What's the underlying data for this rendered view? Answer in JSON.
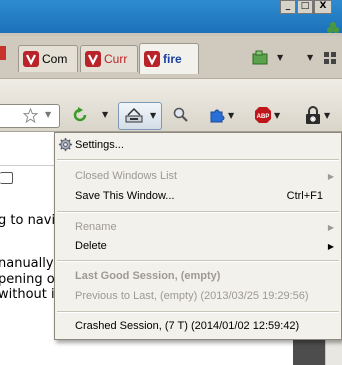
{
  "window": {
    "controls": [
      "_",
      "□",
      "X"
    ]
  },
  "tabs": [
    {
      "label": "Com",
      "selected": false
    },
    {
      "label": "Curr",
      "selected": false
    },
    {
      "label": "fire",
      "selected": true
    }
  ],
  "page": {
    "lines": [
      "g to navi",
      "nanually c",
      "pening of",
      "without i"
    ]
  },
  "menu": {
    "settings": "Settings...",
    "closed_windows": "Closed Windows List",
    "save_window": "Save This Window...",
    "save_window_shortcut": "Ctrl+F1",
    "rename": "Rename",
    "delete": "Delete",
    "last_good_session": "Last Good Session, (empty)",
    "previous_to_last": "Previous to Last, (empty) (2013/03/25 19:29:56)",
    "crashed_session": "Crashed Session, (7 T) (2014/01/02 12:59:42)"
  },
  "icons": {
    "abp_text": "ABP"
  },
  "colors": {
    "menu_bg": "#f3f1ec",
    "disabled_text": "#9d9a92",
    "tab_icon_red": "#b8242a",
    "titlebar_blue": "#1a6fb7"
  }
}
